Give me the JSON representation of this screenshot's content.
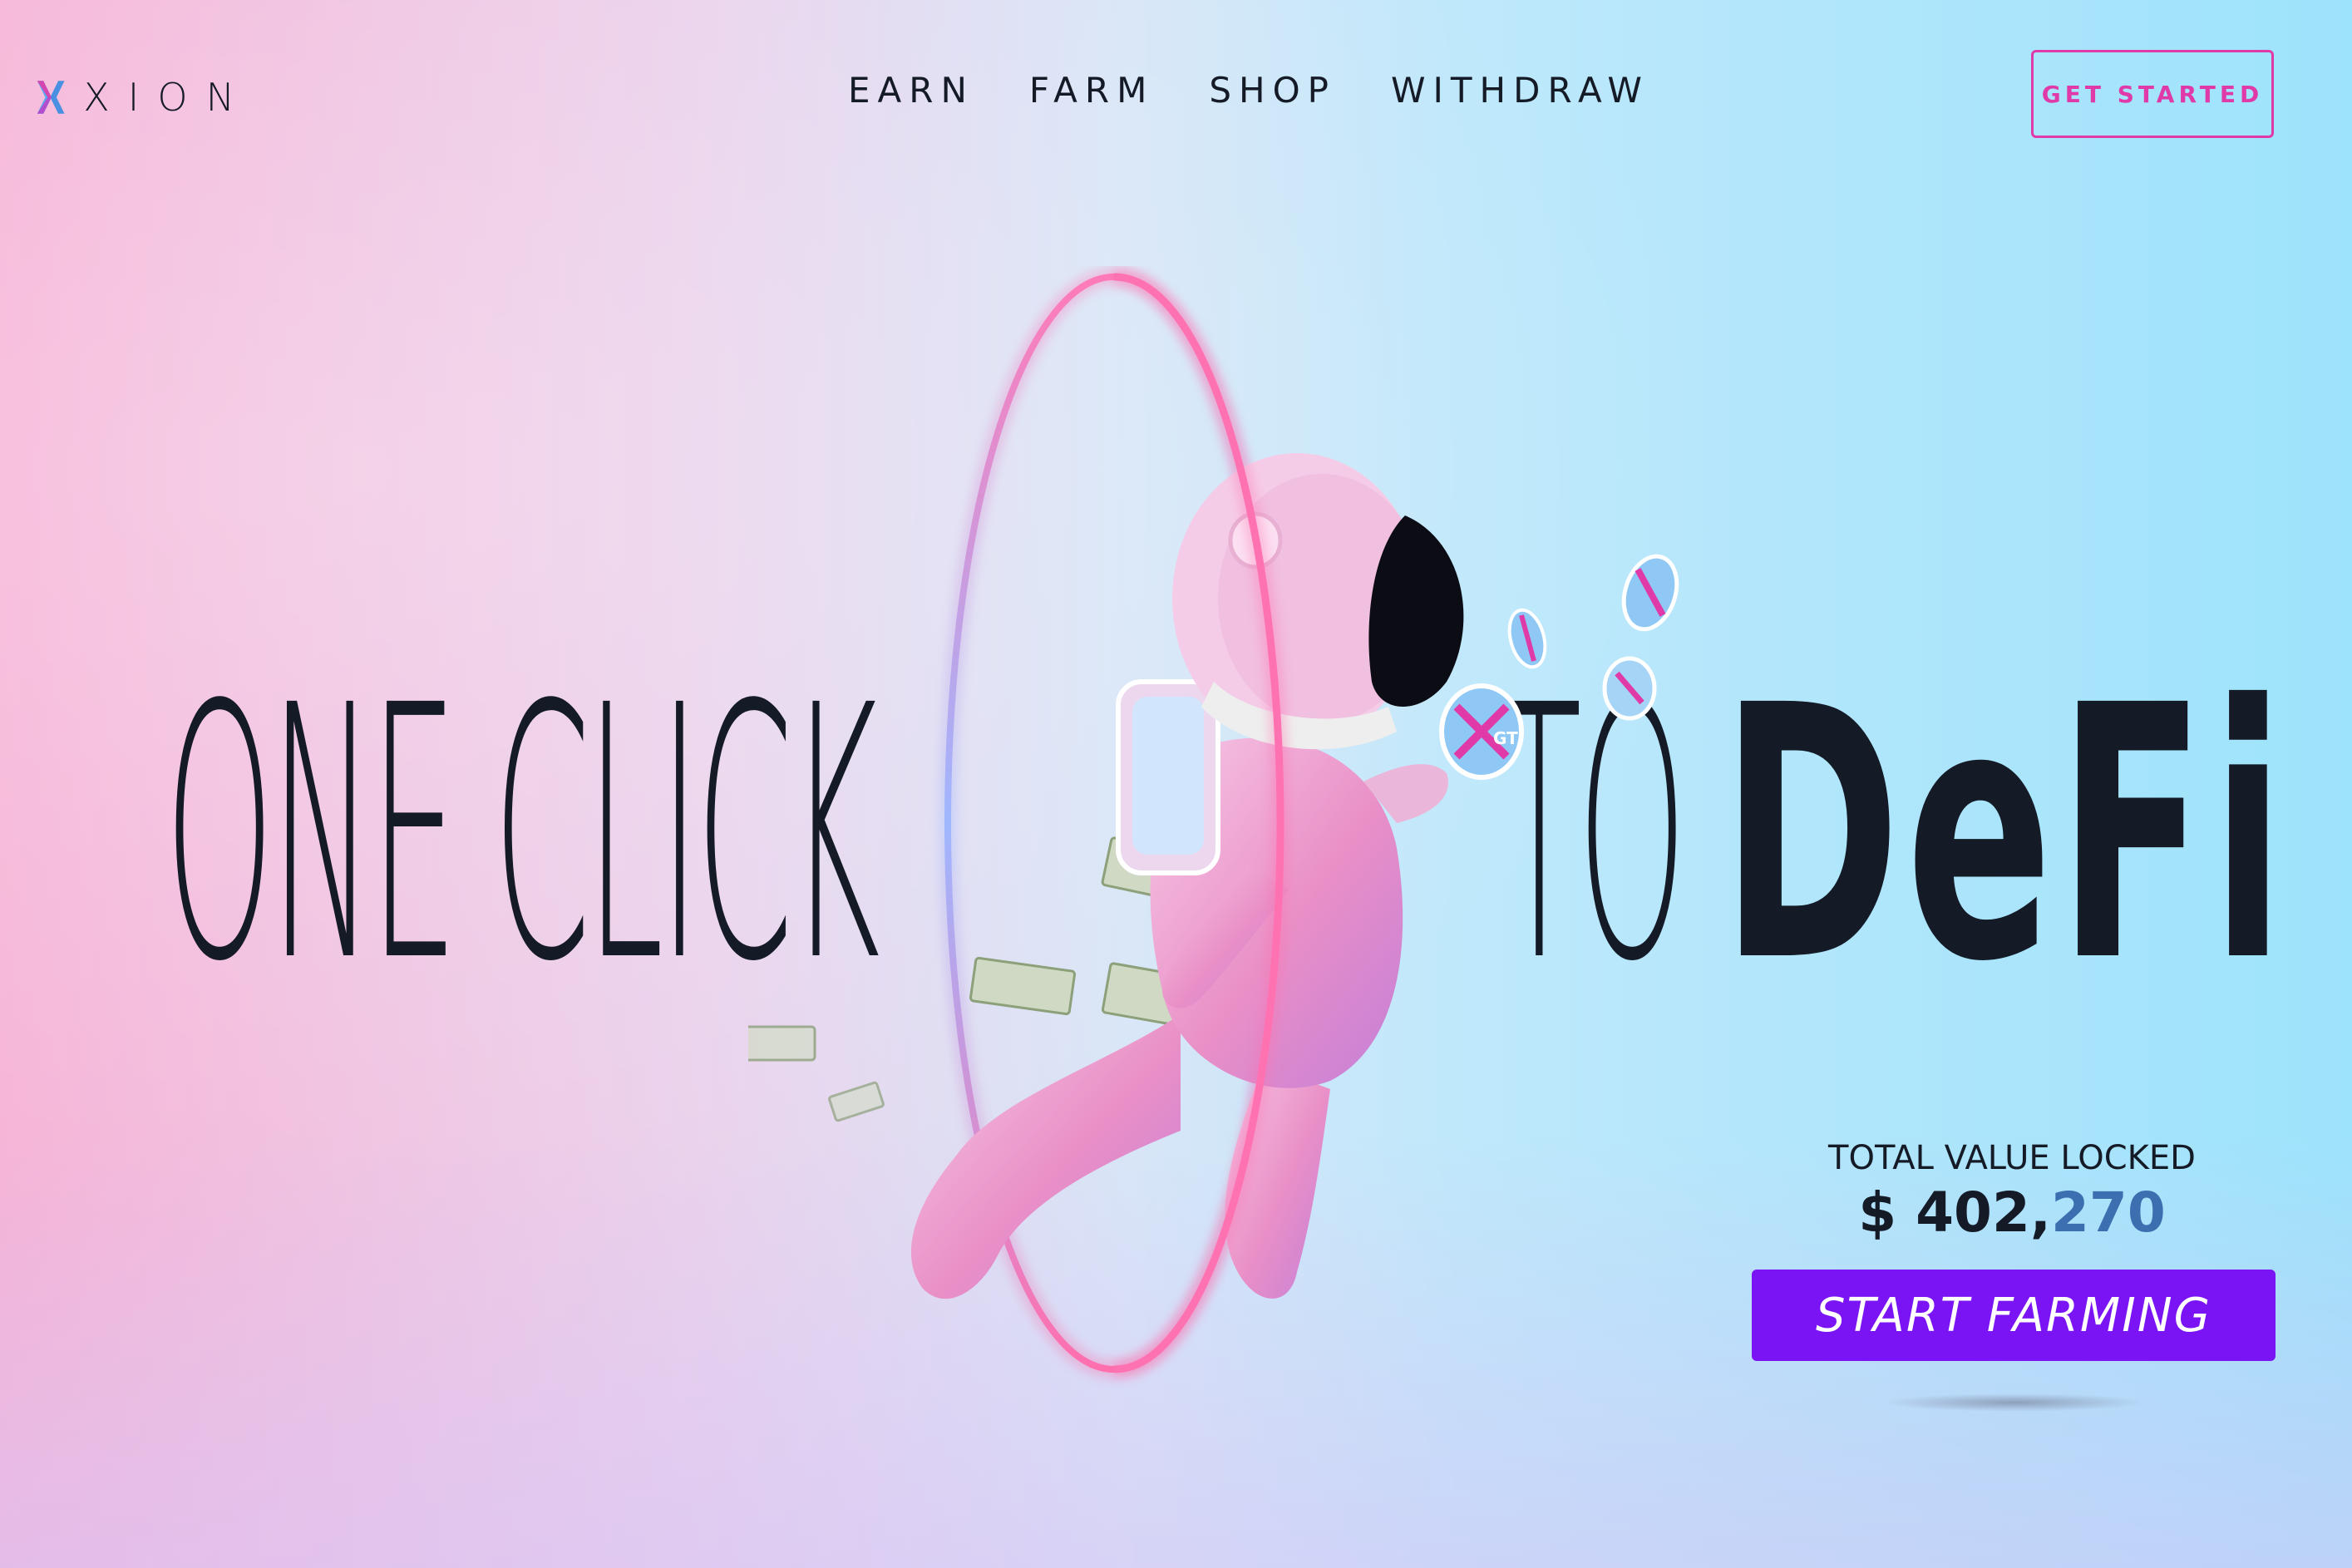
{
  "brand": {
    "name": "XION",
    "colors": {
      "pink": "#e03aa9",
      "blue": "#5aa9f0",
      "purple": "#7b14f5",
      "dark": "#151a27"
    }
  },
  "nav": {
    "items": [
      "EARN",
      "FARM",
      "SHOP",
      "WITHDRAW"
    ]
  },
  "header": {
    "cta_label": "GET STARTED"
  },
  "hero": {
    "headline_left": "ONE CLICK",
    "headline_to": "TO",
    "headline_defi": "DeFi",
    "coin_label": "GT"
  },
  "stats": {
    "label": "TOTAL VALUE LOCKED",
    "value_prefix": "$ 402,",
    "value_suffix": "270"
  },
  "cta": {
    "label": "START FARMING"
  },
  "icons": [
    "xion-logo-icon",
    "astronaut-illustration",
    "neon-ring",
    "coin-icon",
    "dollar-bill-icon"
  ]
}
